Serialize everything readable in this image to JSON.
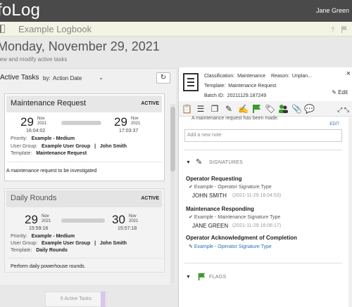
{
  "header": {
    "brand": "foLog",
    "user": "Jane Green"
  },
  "logbook": {
    "title": "Example Logbook",
    "help": "?"
  },
  "page": {
    "date": "Monday, November 29, 2021",
    "subtitle": "iew and modify active tasks"
  },
  "tasks_panel": {
    "title": "Active Tasks",
    "sort_label": "by:",
    "sort_value": "Action Date",
    "refresh_icon": "refresh-icon",
    "footer_count": "6 Active Tasks"
  },
  "tasks": [
    {
      "name": "Maintenance Request",
      "status": "ACTIVE",
      "start": {
        "day": "29",
        "month": "Nov",
        "year": "2021",
        "time": "16:04:02"
      },
      "end": {
        "day": "29",
        "month": "Nov",
        "year": "2021",
        "time": "17:03:37"
      },
      "priority_label": "Priority:",
      "priority": "Example - Medium",
      "usergroup_label": "User Group:",
      "usergroup": "Example User Group",
      "sep": "|",
      "user": "John Smith",
      "template_label": "Template:",
      "template": "Maintenance Request",
      "description": "A maintenance request to be investigated"
    },
    {
      "name": "Daily Rounds",
      "status": "ACTIVE",
      "start": {
        "day": "29",
        "month": "Nov",
        "year": "2021",
        "time": "15:59:16"
      },
      "end": {
        "day": "30",
        "month": "Nov",
        "year": "2021",
        "time": "15:57:18"
      },
      "priority_label": "Priority:",
      "priority": "Example - Medium",
      "usergroup_label": "User Group:",
      "usergroup": "Example User Group",
      "sep": "|",
      "user": "John Smith",
      "template_label": "Template:",
      "template": "Daily Rounds",
      "description": "Perform daily powerhouse rounds."
    }
  ],
  "detail": {
    "classification_label": "Classification:",
    "classification": "Maintenance",
    "reason_label": "Reason:",
    "reason": "Unplan...",
    "template_label": "Template:",
    "template": "Maintenance Request",
    "batch_label": "Batch ID:",
    "batch": "20211129.187249",
    "edit_label": "Edit",
    "close": "×",
    "message": "A maintenance request has been made.",
    "edit_link": "EDIT",
    "note_placeholder": "Add a new note",
    "signatures_header": "SIGNATURES",
    "flags_header": "FLAGS",
    "signatures": [
      {
        "title": "Operator Requesting",
        "type": "Example - Operator Signature Type",
        "name": "JOHN SMITH",
        "time": "(2021-11-29 16:04:53)"
      },
      {
        "title": "Maintenance Responding",
        "type": "Example - Maintenance Signature Type",
        "name": "JANE GREEN",
        "time": "(2021-11-29 16:06:17)"
      }
    ],
    "pending_signature": {
      "title": "Operator Acknowledgment of Completion",
      "type": "Example - Operator Signature Type"
    }
  },
  "colors": {
    "header_bg": "#4a4a4a",
    "link": "#2a6ebb",
    "flag": "#3a9a2a"
  }
}
